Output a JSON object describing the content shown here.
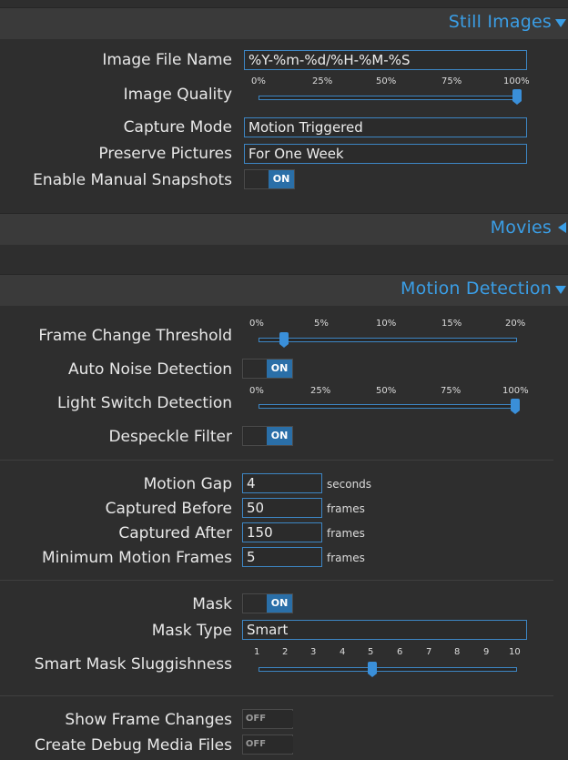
{
  "sections": {
    "still_images": "Still Images",
    "movies": "Movies",
    "motion_detection": "Motion Detection"
  },
  "still": {
    "image_file_name_label": "Image File Name",
    "image_file_name_value": "%Y-%m-%d/%H-%M-%S",
    "image_quality_label": "Image Quality",
    "image_quality_ticks": [
      "0%",
      "25%",
      "50%",
      "75%",
      "100%"
    ],
    "image_quality_value": 1.0,
    "capture_mode_label": "Capture Mode",
    "capture_mode_value": "Motion Triggered",
    "preserve_pictures_label": "Preserve Pictures",
    "preserve_pictures_value": "For One Week",
    "manual_snapshots_label": "Enable Manual Snapshots",
    "manual_snapshots_state": "ON"
  },
  "motion": {
    "frame_change_label": "Frame Change Threshold",
    "frame_change_ticks": [
      "0%",
      "5%",
      "10%",
      "15%",
      "20%"
    ],
    "frame_change_value": 0.02,
    "auto_noise_label": "Auto Noise Detection",
    "auto_noise_state": "ON",
    "light_switch_label": "Light Switch Detection",
    "light_switch_ticks": [
      "0%",
      "25%",
      "50%",
      "75%",
      "100%"
    ],
    "light_switch_value": 1.0,
    "despeckle_label": "Despeckle Filter",
    "despeckle_state": "ON",
    "motion_gap_label": "Motion Gap",
    "motion_gap_value": "4",
    "motion_gap_unit": "seconds",
    "captured_before_label": "Captured Before",
    "captured_before_value": "50",
    "captured_before_unit": "frames",
    "captured_after_label": "Captured After",
    "captured_after_value": "150",
    "captured_after_unit": "frames",
    "min_motion_frames_label": "Minimum Motion Frames",
    "min_motion_frames_value": "5",
    "min_motion_frames_unit": "frames",
    "mask_label": "Mask",
    "mask_state": "ON",
    "mask_type_label": "Mask Type",
    "mask_type_value": "Smart",
    "sluggishness_label": "Smart Mask Sluggishness",
    "sluggishness_ticks": [
      "1",
      "2",
      "3",
      "4",
      "5",
      "6",
      "7",
      "8",
      "9",
      "10"
    ],
    "sluggishness_value": 5,
    "show_frame_changes_label": "Show Frame Changes",
    "show_frame_changes_state": "OFF",
    "debug_media_label": "Create Debug Media Files",
    "debug_media_state": "OFF"
  },
  "colors": {
    "accent": "#3a9ee6",
    "toggle_on": "#2a6fa8",
    "background": "#2e2e2e",
    "header": "#3a3a3a"
  }
}
